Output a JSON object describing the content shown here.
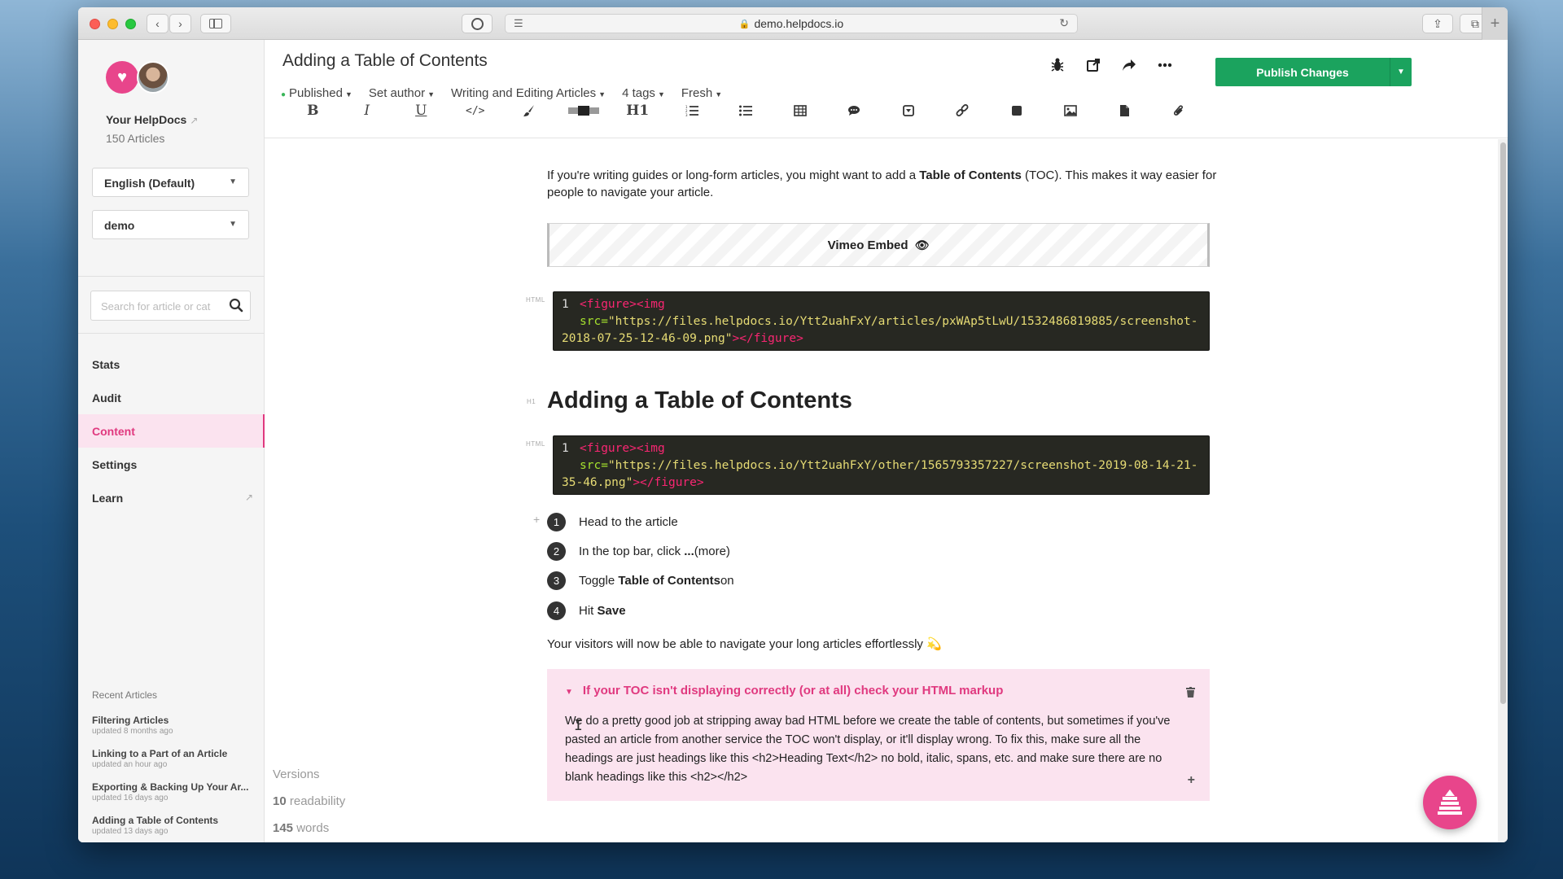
{
  "browser": {
    "url": "demo.helpdocs.io"
  },
  "sidebar": {
    "site_name": "Your HelpDocs",
    "article_count": "150 Articles",
    "language_select": "English (Default)",
    "project_select": "demo",
    "search_placeholder": "Search for article or cat",
    "nav": [
      {
        "label": "Stats"
      },
      {
        "label": "Audit"
      },
      {
        "label": "Content"
      },
      {
        "label": "Settings"
      },
      {
        "label": "Learn"
      }
    ],
    "recent_title": "Recent Articles",
    "recent": [
      {
        "title": "Filtering Articles",
        "updated": "updated 8 months ago"
      },
      {
        "title": "Linking to a Part of an Article",
        "updated": "updated an hour ago"
      },
      {
        "title": "Exporting & Backing Up Your Ar...",
        "updated": "updated 16 days ago"
      },
      {
        "title": "Adding a Table of Contents",
        "updated": "updated 13 days ago"
      }
    ]
  },
  "header": {
    "title": "Adding a Table of Contents",
    "status": "Published",
    "author": "Set author",
    "category": "Writing and Editing Articles",
    "tags": "4 tags",
    "freshness": "Fresh",
    "publish_label": "Publish Changes"
  },
  "toolbar": {
    "heading_label": "H1"
  },
  "content": {
    "intro_1": "If you're writing guides or long-form articles, you might want to add a ",
    "intro_bold": "Table of Contents",
    "intro_2": " (TOC). This makes it way easier for people to navigate your article.",
    "vimeo_label": "Vimeo Embed",
    "gutter_html": "HTML",
    "gutter_h1": "H1",
    "code1": {
      "line": "1",
      "open": "<figure><img",
      "attr": "src=",
      "str": "\"https://files.helpdocs.io/Ytt2uahFxY/articles/pxWAp5tLwU/1532486819885/screenshot-2018-07-25-12-46-09.png\"",
      "close": "></figure>"
    },
    "heading": "Adding a Table of Contents",
    "code2": {
      "line": "1",
      "open": "<figure><img",
      "attr": "src=",
      "str": "\"https://files.helpdocs.io/Ytt2uahFxY/other/1565793357227/screenshot-2019-08-14-21-35-46.png\"",
      "close": "></figure>"
    },
    "steps": [
      {
        "num": "1",
        "text": "Head to the article",
        "bold": ""
      },
      {
        "num": "2",
        "text": "In the top bar, click ",
        "bold": "... ",
        "tail": "(more)"
      },
      {
        "num": "3",
        "text": "Toggle ",
        "bold": "Table of Contents",
        "tail": " on"
      },
      {
        "num": "4",
        "text": "Hit ",
        "bold": "Save"
      }
    ],
    "outro": "Your visitors will now be able to navigate your long articles effortlessly 💫",
    "callout_title": "If your TOC isn't displaying correctly (or at all) check your HTML markup",
    "callout_body": "We do a pretty good job at stripping away bad HTML before we create the table of contents, but sometimes if you've pasted an article from another service the TOC won't display, or it'll display wrong. To fix this, make sure all the headings are just headings like this <h2>Heading Text</h2> no bold, italic, spans, etc. and make sure there are no blank headings like this <h2></h2>"
  },
  "stats": {
    "versions": "Versions",
    "readability_num": "10",
    "readability_lbl": "readability",
    "words_num": "145",
    "words_lbl": "words"
  },
  "icons": [
    "back-icon",
    "forward-icon",
    "sidebar-icon",
    "password-icon",
    "reader-icon",
    "lock-icon",
    "reload-icon",
    "share-icon",
    "tabs-icon",
    "bug-icon",
    "external-link-icon",
    "share-arrow-icon",
    "more-icon",
    "bold-icon",
    "italic-icon",
    "underline-icon",
    "code-icon",
    "brush-icon",
    "toggle-icon",
    "heading-icon",
    "ordered-list-icon",
    "bullet-list-icon",
    "table-icon",
    "comment-icon",
    "dropdown-box-icon",
    "link-icon",
    "square-icon",
    "image-icon",
    "file-icon",
    "attachment-icon",
    "search-icon",
    "trash-icon",
    "plus-icon",
    "eye-icon"
  ],
  "colors": {
    "accent": "#e0397f",
    "publish": "#1ba35e",
    "callout_bg": "#fbe3ef"
  }
}
